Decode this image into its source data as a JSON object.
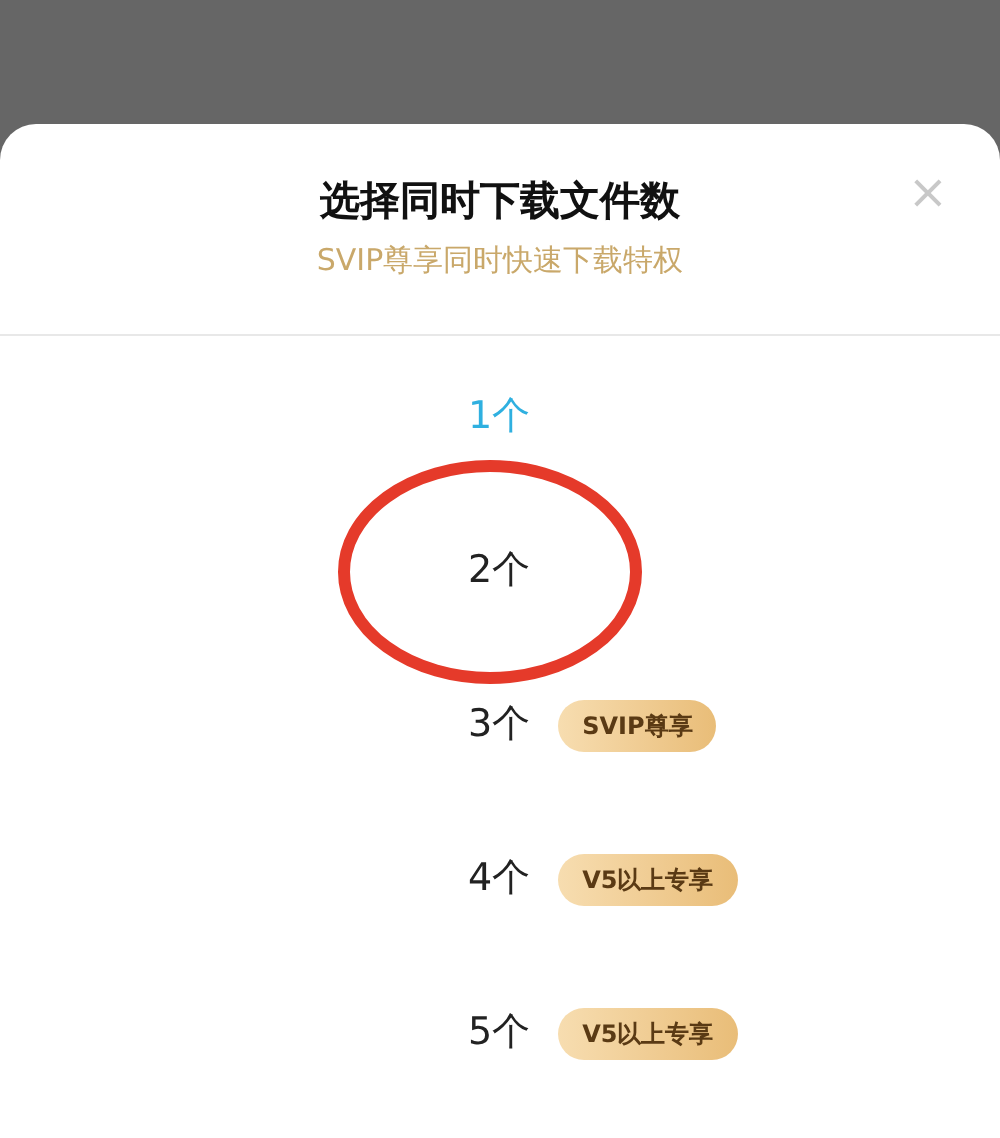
{
  "sheet": {
    "title": "选择同时下载文件数",
    "subtitle": "SVIP尊享同时快速下载特权",
    "close": "×"
  },
  "options": [
    {
      "label": "1个",
      "selected": true
    },
    {
      "label": "2个",
      "selected": false
    },
    {
      "label": "3个",
      "selected": false,
      "badge": "SVIP尊享"
    },
    {
      "label": "4个",
      "selected": false,
      "badge": "V5以上专享"
    },
    {
      "label": "5个",
      "selected": false,
      "badge": "V5以上专享"
    }
  ]
}
